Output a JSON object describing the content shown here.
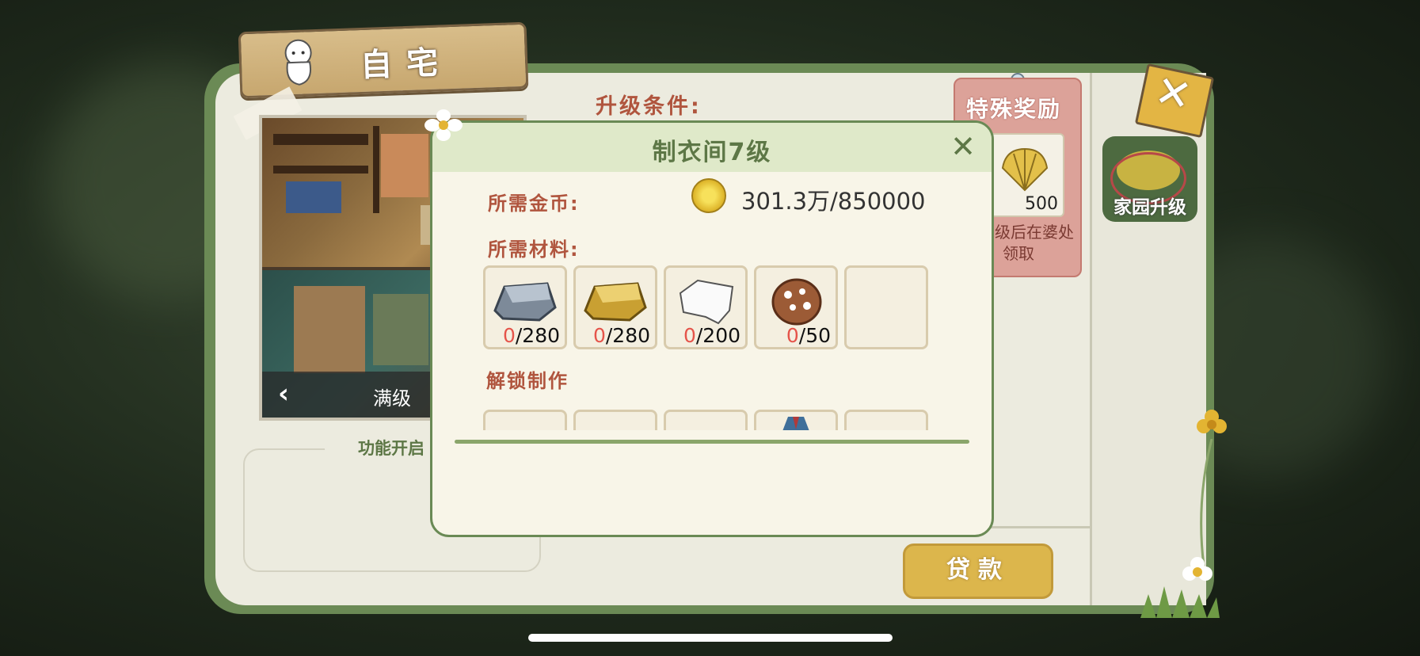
{
  "header": {
    "title": "自宅"
  },
  "room_preview": {
    "level_label": "满级"
  },
  "feature": {
    "tab_label": "功能开启"
  },
  "upgrade": {
    "conditions_label": "升级条件:"
  },
  "reward": {
    "title": "特殊奖励",
    "item_count": "500",
    "note": "宅升级后在婆处领取"
  },
  "sidebar": {
    "home_upgrade_label": "家园升级"
  },
  "loan": {
    "label": "贷款"
  },
  "modal": {
    "title": "制衣间7级",
    "gold_label": "所需金币:",
    "gold_value": "301.3万/850000",
    "materials_label": "所需材料:",
    "materials": [
      {
        "icon": "silver-ingot-icon",
        "have": "0",
        "need": "/280"
      },
      {
        "icon": "gold-ingot-icon",
        "have": "0",
        "need": "/280"
      },
      {
        "icon": "white-cloth-icon",
        "have": "0",
        "need": "/200"
      },
      {
        "icon": "cookie-icon",
        "have": "0",
        "need": "/50"
      }
    ],
    "unlock_label": "解锁制作"
  },
  "colors": {
    "accent_green": "#5d7746",
    "label_red": "#b0553e",
    "count_red": "#e5544a",
    "gold": "#dcb64c"
  }
}
